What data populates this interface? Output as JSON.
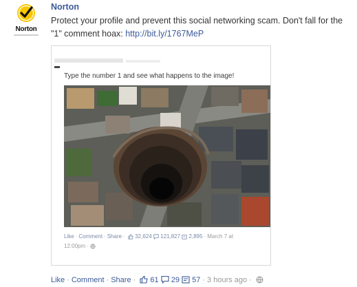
{
  "author": {
    "name": "Norton",
    "avatar_label": "Norton",
    "avatar_icon": "checkmark-seal-icon",
    "brand_colors": {
      "seal": "#f7c600",
      "check": "#111111"
    }
  },
  "post": {
    "text": "Protect your profile and prevent this social networking scam. Don't fall for the \"1\" comment hoax: ",
    "link": "http://bit.ly/1767MeP"
  },
  "shared_image": {
    "caption": "Type the number 1 and see what happens to the image!",
    "photo_subject": "sinkhole-aerial-photo",
    "actions": {
      "like": "Like",
      "comment": "Comment",
      "share": "Share",
      "likes": "32,624",
      "comments": "121,827",
      "shares": "2,895",
      "date": "March 7 at",
      "time": "12:00pm"
    }
  },
  "actions": {
    "like": "Like",
    "comment": "Comment",
    "share": "Share",
    "likes": "61",
    "comments": "29",
    "shares": "57",
    "time": "3 hours ago"
  },
  "colors": {
    "link": "#3b5998",
    "text": "#333333",
    "muted": "#999999"
  }
}
